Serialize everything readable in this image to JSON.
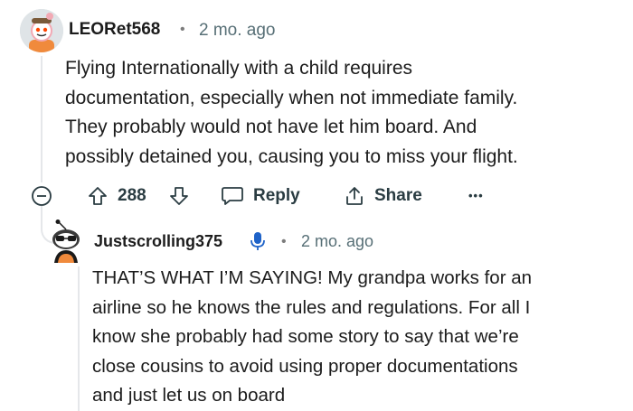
{
  "comment": {
    "username": "LEORet568",
    "separator": "•",
    "time": "2 mo. ago",
    "lines": [
      "Flying Internationally with a child requires",
      "documentation, especially when not immediate family.",
      "They probably would not have let him board. And",
      "possibly detained you, causing you to miss your flight."
    ],
    "votes": "288",
    "reply_label": "Reply",
    "share_label": "Share",
    "more_label": "•••"
  },
  "reply": {
    "username": "Justscrolling375",
    "separator": "•",
    "time": "2 mo. ago",
    "lines": [
      "THAT’S WHAT I’M SAYING! My grandpa works for an",
      "airline so he knows the rules and regulations. For all I",
      "know she probably had some story to say that we’re",
      "close cousins to avoid using proper documentations",
      "and just let us on board"
    ]
  },
  "colors": {
    "text": "#1c1c1c",
    "meta": "#576f76",
    "action": "#2a3c42",
    "thread_line": "#e5e7ea",
    "voice_icon": "#1e62c8"
  }
}
